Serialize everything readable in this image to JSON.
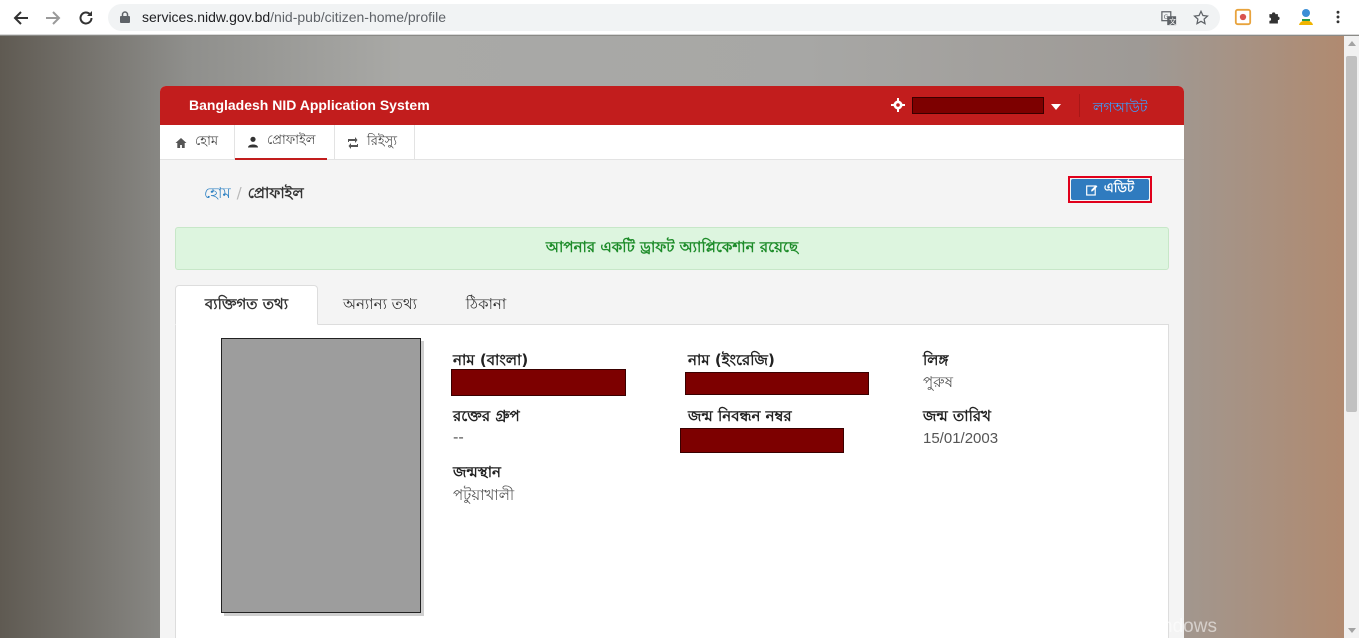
{
  "browser": {
    "url_domain": "services.nidw.gov.bd",
    "url_path": "/nid-pub/citizen-home/profile"
  },
  "app": {
    "brand": "Bangladesh NID Application System",
    "logout": "লগআউট",
    "colors": {
      "header": "#c21d1d",
      "edit_button": "#2f7bbf",
      "alert_bg": "#ddf5df",
      "alert_text": "#1e8c2a",
      "redaction": "#7d0000"
    }
  },
  "menu": {
    "tabs": [
      {
        "label": "হোম",
        "icon": "home-icon"
      },
      {
        "label": "প্রোফাইল",
        "icon": "user-icon",
        "active": true
      },
      {
        "label": "রিইস্যু",
        "icon": "retweet-icon"
      }
    ]
  },
  "breadcrumb": {
    "home": "হোম",
    "separator": "/",
    "current": "প্রোফাইল"
  },
  "edit_button": {
    "label": "এডিট",
    "icon": "edit-icon"
  },
  "alert": {
    "message": "আপনার একটি ড্রাফট অ্যাপ্লিকেশান রয়েছে"
  },
  "info_tabs": [
    {
      "label": "ব্যক্তিগত তথ্য",
      "active": true
    },
    {
      "label": "অন্যান্য তথ্য"
    },
    {
      "label": "ঠিকানা"
    }
  ],
  "profile": {
    "name_bn": {
      "label": "নাম (বাংলা)",
      "value": "[redacted]"
    },
    "name_en": {
      "label": "নাম (ইংরেজি)",
      "value": "[redacted]"
    },
    "gender": {
      "label": "লিঙ্গ",
      "value": "পুরুষ"
    },
    "blood_group": {
      "label": "রক্তের গ্রুপ",
      "value": "--"
    },
    "birth_reg_no": {
      "label": "জন্ম নিবন্ধন নম্বর",
      "value": "[redacted]"
    },
    "dob": {
      "label": "জন্ম তারিখ",
      "value": "15/01/2003"
    },
    "birthplace": {
      "label": "জন্মস্থান",
      "value": "পটুয়াখালী"
    }
  },
  "watermark": "Activate Windows"
}
